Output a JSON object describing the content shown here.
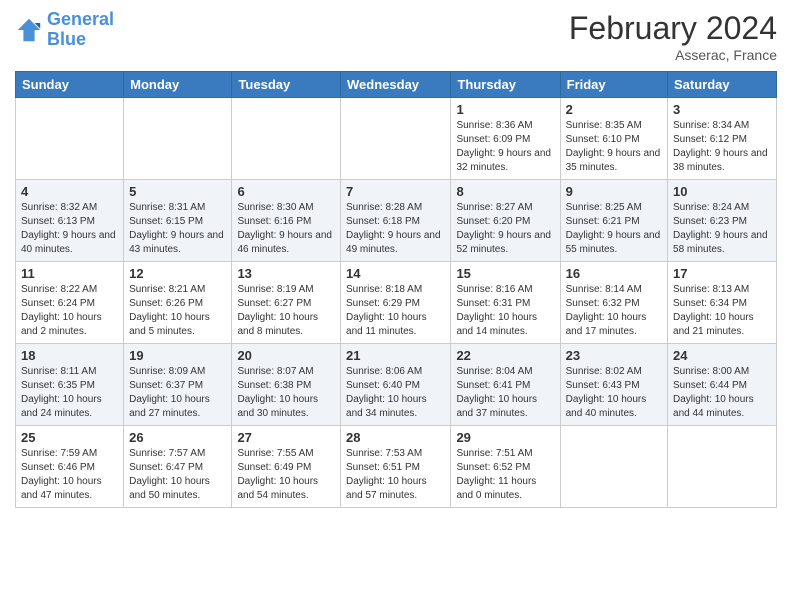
{
  "logo": {
    "line1": "General",
    "line2": "Blue"
  },
  "title": {
    "month_year": "February 2024",
    "location": "Asserac, France"
  },
  "days_of_week": [
    "Sunday",
    "Monday",
    "Tuesday",
    "Wednesday",
    "Thursday",
    "Friday",
    "Saturday"
  ],
  "weeks": [
    [
      {
        "day": "",
        "info": ""
      },
      {
        "day": "",
        "info": ""
      },
      {
        "day": "",
        "info": ""
      },
      {
        "day": "",
        "info": ""
      },
      {
        "day": "1",
        "info": "Sunrise: 8:36 AM\nSunset: 6:09 PM\nDaylight: 9 hours and 32 minutes."
      },
      {
        "day": "2",
        "info": "Sunrise: 8:35 AM\nSunset: 6:10 PM\nDaylight: 9 hours and 35 minutes."
      },
      {
        "day": "3",
        "info": "Sunrise: 8:34 AM\nSunset: 6:12 PM\nDaylight: 9 hours and 38 minutes."
      }
    ],
    [
      {
        "day": "4",
        "info": "Sunrise: 8:32 AM\nSunset: 6:13 PM\nDaylight: 9 hours and 40 minutes."
      },
      {
        "day": "5",
        "info": "Sunrise: 8:31 AM\nSunset: 6:15 PM\nDaylight: 9 hours and 43 minutes."
      },
      {
        "day": "6",
        "info": "Sunrise: 8:30 AM\nSunset: 6:16 PM\nDaylight: 9 hours and 46 minutes."
      },
      {
        "day": "7",
        "info": "Sunrise: 8:28 AM\nSunset: 6:18 PM\nDaylight: 9 hours and 49 minutes."
      },
      {
        "day": "8",
        "info": "Sunrise: 8:27 AM\nSunset: 6:20 PM\nDaylight: 9 hours and 52 minutes."
      },
      {
        "day": "9",
        "info": "Sunrise: 8:25 AM\nSunset: 6:21 PM\nDaylight: 9 hours and 55 minutes."
      },
      {
        "day": "10",
        "info": "Sunrise: 8:24 AM\nSunset: 6:23 PM\nDaylight: 9 hours and 58 minutes."
      }
    ],
    [
      {
        "day": "11",
        "info": "Sunrise: 8:22 AM\nSunset: 6:24 PM\nDaylight: 10 hours and 2 minutes."
      },
      {
        "day": "12",
        "info": "Sunrise: 8:21 AM\nSunset: 6:26 PM\nDaylight: 10 hours and 5 minutes."
      },
      {
        "day": "13",
        "info": "Sunrise: 8:19 AM\nSunset: 6:27 PM\nDaylight: 10 hours and 8 minutes."
      },
      {
        "day": "14",
        "info": "Sunrise: 8:18 AM\nSunset: 6:29 PM\nDaylight: 10 hours and 11 minutes."
      },
      {
        "day": "15",
        "info": "Sunrise: 8:16 AM\nSunset: 6:31 PM\nDaylight: 10 hours and 14 minutes."
      },
      {
        "day": "16",
        "info": "Sunrise: 8:14 AM\nSunset: 6:32 PM\nDaylight: 10 hours and 17 minutes."
      },
      {
        "day": "17",
        "info": "Sunrise: 8:13 AM\nSunset: 6:34 PM\nDaylight: 10 hours and 21 minutes."
      }
    ],
    [
      {
        "day": "18",
        "info": "Sunrise: 8:11 AM\nSunset: 6:35 PM\nDaylight: 10 hours and 24 minutes."
      },
      {
        "day": "19",
        "info": "Sunrise: 8:09 AM\nSunset: 6:37 PM\nDaylight: 10 hours and 27 minutes."
      },
      {
        "day": "20",
        "info": "Sunrise: 8:07 AM\nSunset: 6:38 PM\nDaylight: 10 hours and 30 minutes."
      },
      {
        "day": "21",
        "info": "Sunrise: 8:06 AM\nSunset: 6:40 PM\nDaylight: 10 hours and 34 minutes."
      },
      {
        "day": "22",
        "info": "Sunrise: 8:04 AM\nSunset: 6:41 PM\nDaylight: 10 hours and 37 minutes."
      },
      {
        "day": "23",
        "info": "Sunrise: 8:02 AM\nSunset: 6:43 PM\nDaylight: 10 hours and 40 minutes."
      },
      {
        "day": "24",
        "info": "Sunrise: 8:00 AM\nSunset: 6:44 PM\nDaylight: 10 hours and 44 minutes."
      }
    ],
    [
      {
        "day": "25",
        "info": "Sunrise: 7:59 AM\nSunset: 6:46 PM\nDaylight: 10 hours and 47 minutes."
      },
      {
        "day": "26",
        "info": "Sunrise: 7:57 AM\nSunset: 6:47 PM\nDaylight: 10 hours and 50 minutes."
      },
      {
        "day": "27",
        "info": "Sunrise: 7:55 AM\nSunset: 6:49 PM\nDaylight: 10 hours and 54 minutes."
      },
      {
        "day": "28",
        "info": "Sunrise: 7:53 AM\nSunset: 6:51 PM\nDaylight: 10 hours and 57 minutes."
      },
      {
        "day": "29",
        "info": "Sunrise: 7:51 AM\nSunset: 6:52 PM\nDaylight: 11 hours and 0 minutes."
      },
      {
        "day": "",
        "info": ""
      },
      {
        "day": "",
        "info": ""
      }
    ]
  ]
}
